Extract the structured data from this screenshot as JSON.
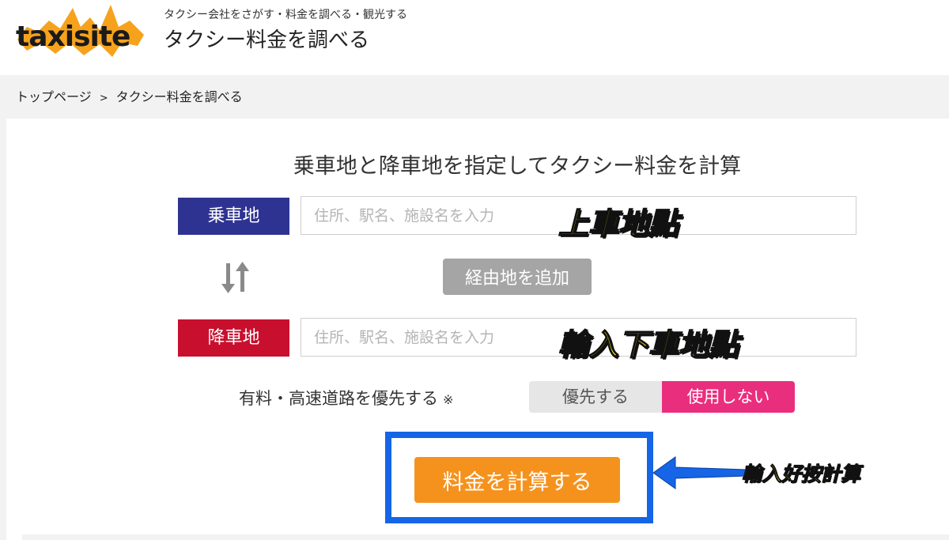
{
  "header": {
    "logo_text": "taxisite",
    "tagline": "タクシー会社をさがす・料金を調べる・観光する",
    "title": "タクシー料金を調べる"
  },
  "breadcrumb": {
    "items": [
      "トップページ",
      "タクシー料金を調べる"
    ],
    "separator": ">"
  },
  "form": {
    "heading": "乗車地と降車地を指定してタクシー料金を計算",
    "pickup_label": "乗車地",
    "pickup_placeholder": "住所、駅名、施設名を入力",
    "dropoff_label": "降車地",
    "dropoff_placeholder": "住所、駅名、施設名を入力",
    "swap_icon": "swap-vertical-icon",
    "via_button": "経由地を追加",
    "toll_label": "有料・高速道路を優先する",
    "toll_note": "※",
    "toll_options": [
      "優先する",
      "使用しない"
    ],
    "toll_selected": "使用しない",
    "calc_button": "料金を計算する"
  },
  "annotations": {
    "pickup": "上車地點",
    "dropoff": "輸入下車地點",
    "calc": "輸入好按計算"
  },
  "colors": {
    "pickup": "#2e3392",
    "dropoff": "#c8102e",
    "selected_toggle": "#ea2e7e",
    "calc_button": "#f5921e",
    "highlight": "#1565e6",
    "annotation": "#ffe600"
  }
}
